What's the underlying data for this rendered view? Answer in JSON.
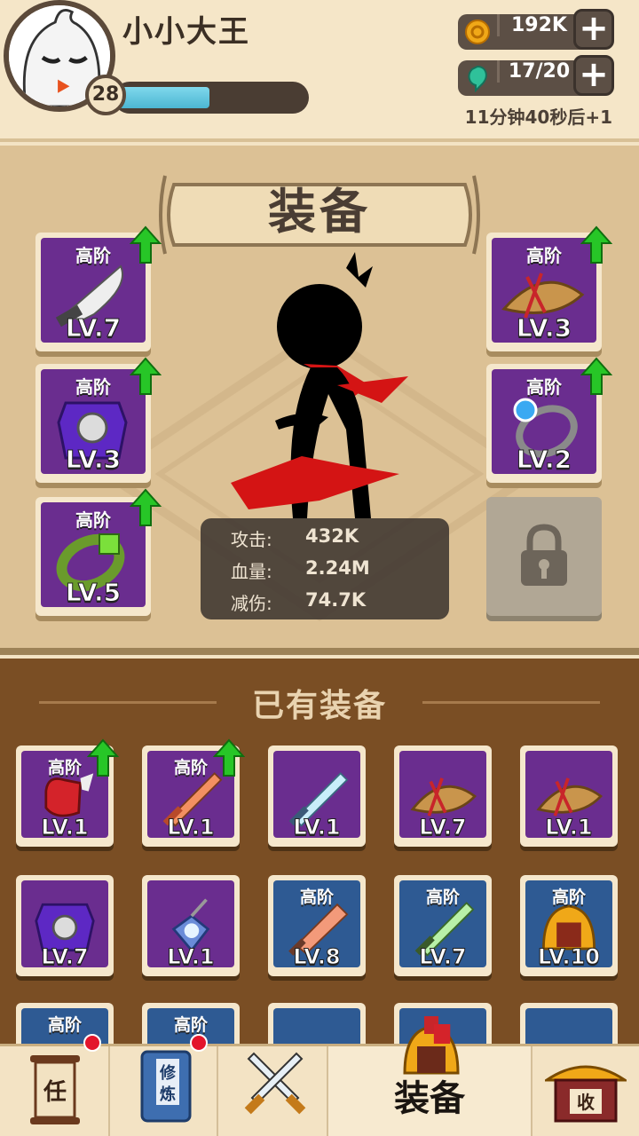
{
  "player": {
    "name": "小小大王",
    "level": "28",
    "xp_fraction": 0.49
  },
  "resources": {
    "gold": {
      "value": "192K",
      "icon": "gold-coin-icon"
    },
    "energy": {
      "value": "17/20",
      "icon": "green-gem-icon"
    },
    "regen_text": "11分钟40秒后+1"
  },
  "equip_panel": {
    "title": "装备",
    "slots": [
      {
        "grade": "高阶",
        "level": "LV.7",
        "item": "saber",
        "upgrade": true
      },
      {
        "grade": "高阶",
        "level": "LV.3",
        "item": "armor",
        "upgrade": true
      },
      {
        "grade": "高阶",
        "level": "LV.5",
        "item": "bracelet",
        "upgrade": true
      },
      {
        "grade": "高阶",
        "level": "LV.3",
        "item": "straw-hat",
        "upgrade": true
      },
      {
        "grade": "高阶",
        "level": "LV.2",
        "item": "ring",
        "upgrade": true
      }
    ],
    "stats": [
      {
        "label": "攻击:",
        "value": "432K"
      },
      {
        "label": "血量:",
        "value": "2.24M"
      },
      {
        "label": "减伤:",
        "value": "74.7K"
      }
    ]
  },
  "owned": {
    "title": "已有装备",
    "items": [
      {
        "grade": "高阶",
        "level": "LV.1",
        "item": "gauntlet",
        "upgrade": true
      },
      {
        "grade": "高阶",
        "level": "LV.1",
        "item": "orange-sword",
        "upgrade": true
      },
      {
        "grade": "",
        "level": "LV.1",
        "item": "blue-sword",
        "upgrade": false
      },
      {
        "grade": "",
        "level": "LV.7",
        "item": "straw-hat",
        "upgrade": false
      },
      {
        "grade": "",
        "level": "LV.1",
        "item": "straw-hat",
        "upgrade": false
      },
      {
        "grade": "",
        "level": "LV.7",
        "item": "armor",
        "upgrade": false
      },
      {
        "grade": "",
        "level": "LV.1",
        "item": "amulet",
        "upgrade": false
      },
      {
        "grade": "高阶",
        "level": "LV.8",
        "item": "cleaver",
        "upgrade": false
      },
      {
        "grade": "高阶",
        "level": "LV.7",
        "item": "green-sword",
        "upgrade": false
      },
      {
        "grade": "高阶",
        "level": "LV.10",
        "item": "helmet",
        "upgrade": false
      },
      {
        "grade": "高阶",
        "level": "",
        "item": "blue-mask",
        "upgrade": false
      },
      {
        "grade": "高阶",
        "level": "",
        "item": "green-ring",
        "upgrade": false
      },
      {
        "grade": "",
        "level": "",
        "item": "claw",
        "upgrade": false
      },
      {
        "grade": "",
        "level": "",
        "item": "helmet-red",
        "upgrade": false
      },
      {
        "grade": "",
        "level": "",
        "item": "blue-mask",
        "upgrade": false
      }
    ]
  },
  "nav": {
    "tabs": [
      {
        "label": "",
        "icon": "task-scroll-icon",
        "glyph": "任"
      },
      {
        "label": "",
        "icon": "cultivation-book-icon",
        "glyph": "修炼"
      },
      {
        "label": "",
        "icon": "crossed-swords-icon"
      },
      {
        "label": "装备",
        "icon": "helmet-icon",
        "active": true
      },
      {
        "label": "",
        "icon": "collection-shop-icon",
        "glyph": "收"
      }
    ]
  }
}
